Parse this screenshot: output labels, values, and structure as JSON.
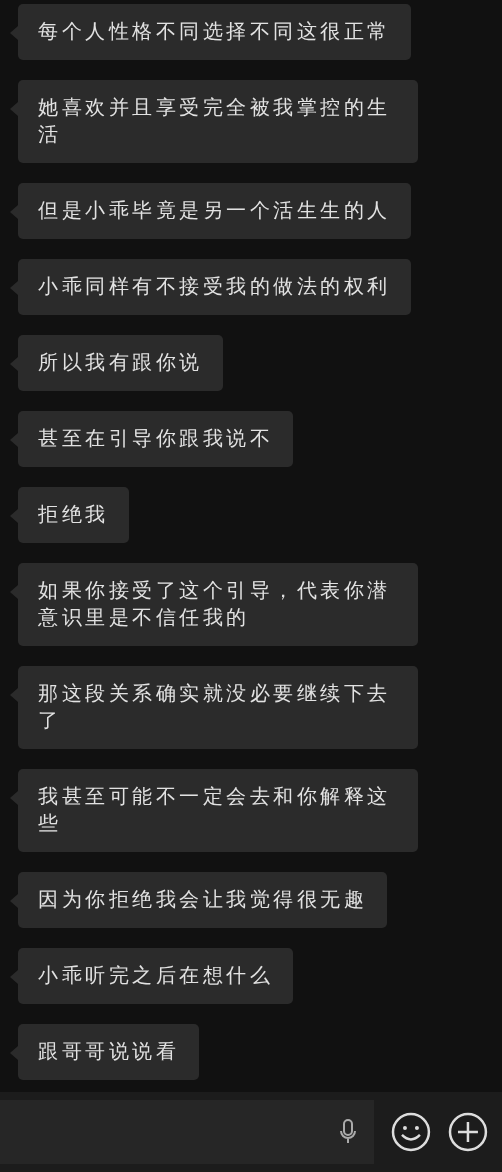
{
  "messages": [
    "每个人性格不同选择不同这很正常",
    "她喜欢并且享受完全被我掌控的生活",
    "但是小乖毕竟是另一个活生生的人",
    "小乖同样有不接受我的做法的权利",
    "所以我有跟你说",
    "甚至在引导你跟我说不",
    "拒绝我",
    "如果你接受了这个引导，代表你潜意识里是不信任我的",
    "那这段关系确实就没必要继续下去了",
    "我甚至可能不一定会去和你解释这些",
    "因为你拒绝我会让我觉得很无趣",
    "小乖听完之后在想什么",
    "跟哥哥说说看"
  ]
}
